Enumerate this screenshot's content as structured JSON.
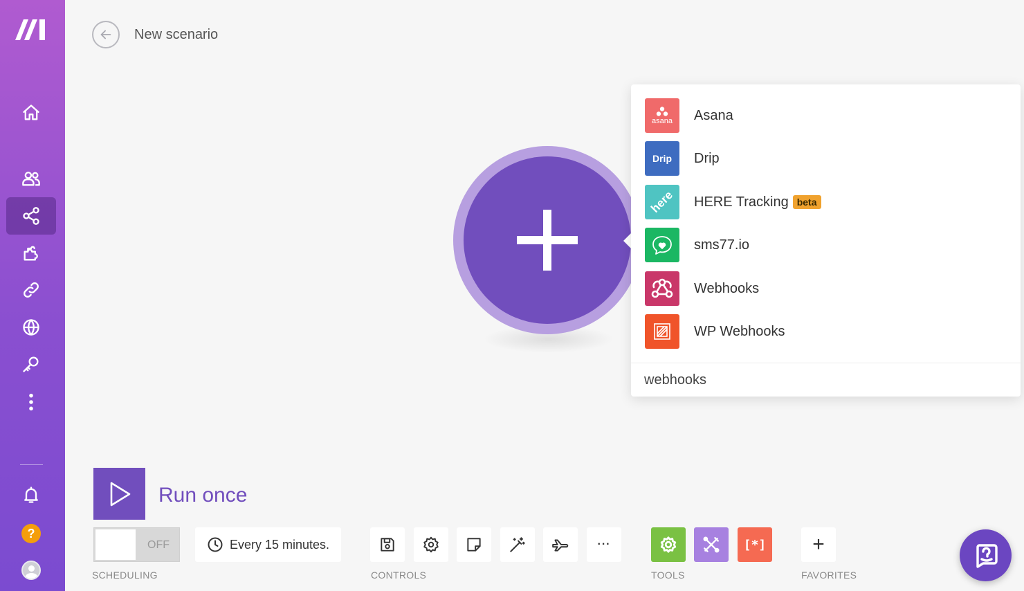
{
  "header": {
    "title": "New scenario"
  },
  "sidebar": {
    "items": [
      {
        "name": "home-icon"
      },
      {
        "name": "team-icon"
      },
      {
        "name": "scenarios-icon",
        "active": true
      },
      {
        "name": "apps-puzzle-icon"
      },
      {
        "name": "connections-link-icon"
      },
      {
        "name": "webhooks-globe-icon"
      },
      {
        "name": "keys-icon"
      },
      {
        "name": "more-dots-icon"
      }
    ],
    "help_label": "?"
  },
  "dropdown": {
    "apps": [
      {
        "name": "Asana",
        "color": "#f06a6a",
        "icon": "asana-icon",
        "icon_text": "asana"
      },
      {
        "name": "Drip",
        "color": "#3e6cc0",
        "icon": "drip-icon",
        "icon_text": "Drip"
      },
      {
        "name": "HERE Tracking",
        "color": "#4fc4c2",
        "icon": "here-icon",
        "icon_text": "here",
        "badge": "beta"
      },
      {
        "name": "sms77.io",
        "color": "#1bb763",
        "icon": "sms-chat-icon"
      },
      {
        "name": "Webhooks",
        "color": "#c93769",
        "icon": "webhooks-icon"
      },
      {
        "name": "WP Webhooks",
        "color": "#f0542a",
        "icon": "wp-webhooks-icon"
      }
    ],
    "search_value": "webhooks"
  },
  "run": {
    "label": "Run once"
  },
  "toolbar": {
    "scheduling": {
      "toggle_state": "OFF",
      "interval": "Every 15 minutes.",
      "label": "SCHEDULING"
    },
    "controls": {
      "label": "CONTROLS",
      "buttons": [
        "save-icon",
        "settings-gear-icon",
        "notes-icon",
        "auto-align-wand-icon",
        "explain-flow-plane-icon",
        "more-icon"
      ],
      "more_text": "···"
    },
    "tools": {
      "label": "TOOLS",
      "buttons": [
        {
          "name": "tools-gear-icon",
          "color": "#7ac143"
        },
        {
          "name": "tools-flow-control-icon",
          "color": "#a781e0"
        },
        {
          "name": "tools-text-parser-icon",
          "color": "#f56a52",
          "text": "[*]"
        }
      ]
    },
    "favorites": {
      "label": "FAVORITES",
      "add_text": "+"
    }
  },
  "colors": {
    "accent": "#714ebd",
    "sidebar_top": "#b05bd0",
    "sidebar_bottom": "#7b4bd0",
    "beta": "#f0a22e"
  }
}
